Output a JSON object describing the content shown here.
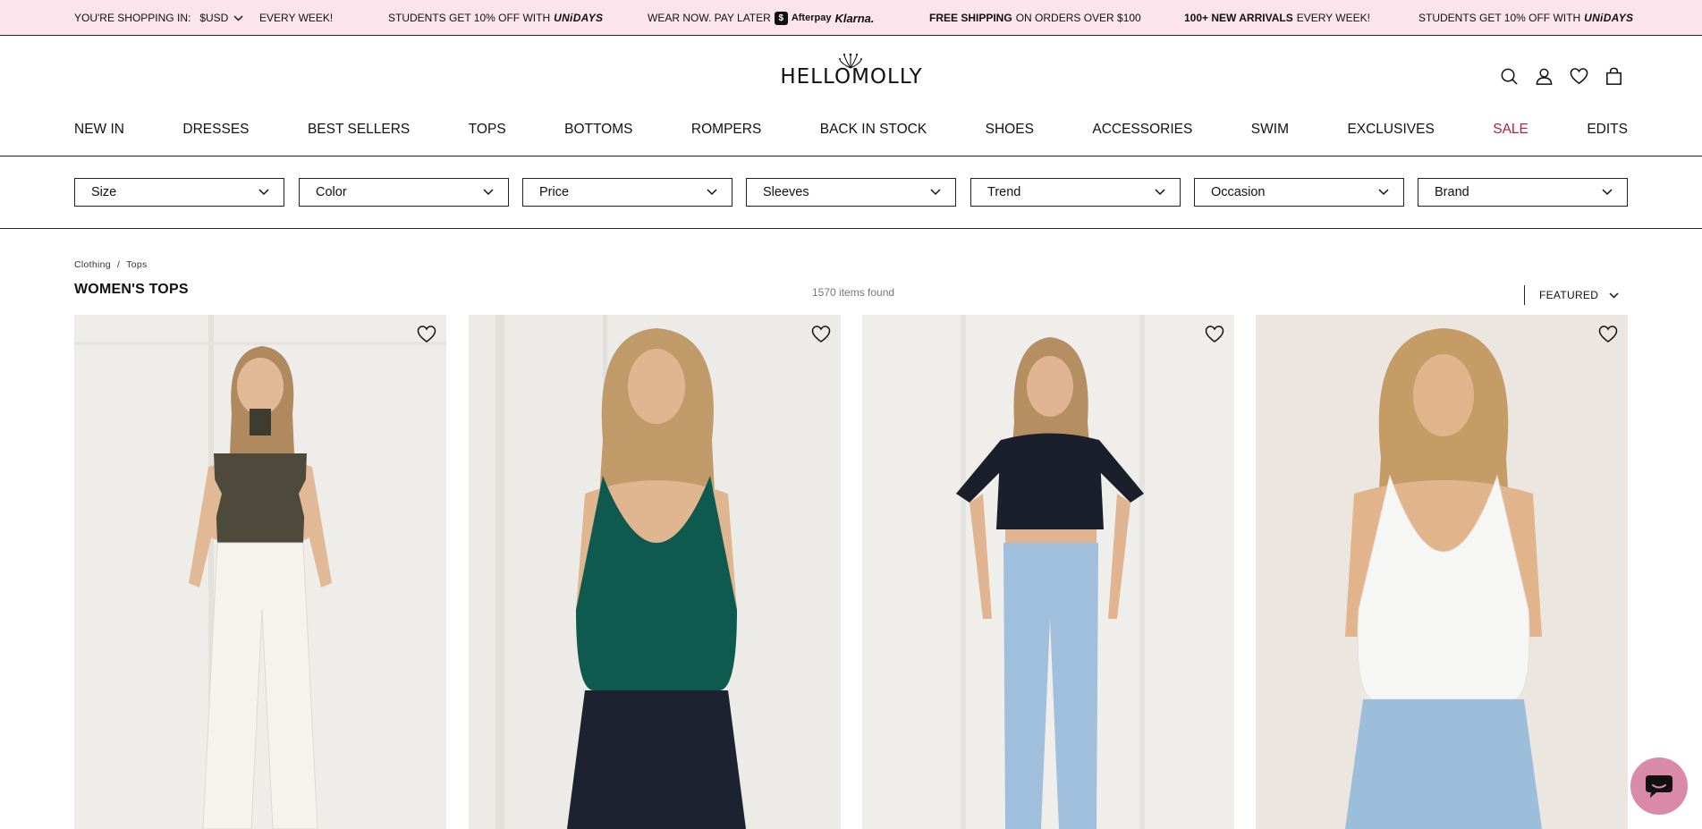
{
  "announcement": {
    "currency_label": "YOU'RE SHOPPING IN:",
    "currency_value": "$USD",
    "ticker": [
      {
        "pre": "",
        "bold": "",
        "post": "EVERY WEEK!"
      },
      {
        "pre": "STUDENTS GET 10% OFF WITH",
        "bold": "UNiDAYS",
        "post": ""
      },
      {
        "pre": "WEAR NOW. PAY LATER",
        "bold": "",
        "post": ""
      },
      {
        "pre": "",
        "bold": "FREE SHIPPING",
        "post": "ON ORDERS OVER $100"
      },
      {
        "pre": "",
        "bold": "100+ NEW ARRIVALS",
        "post": "EVERY WEEK!"
      },
      {
        "pre": "STUDENTS GET 10% OFF WITH",
        "bold": "UNiDAYS",
        "post": ""
      }
    ],
    "afterpay_label": "Afterpay",
    "klarna_label": "Klarna."
  },
  "header": {
    "logo_text": "HELLOMOLLY",
    "icons": [
      "search-icon",
      "account-icon",
      "wishlist-icon",
      "bag-icon"
    ]
  },
  "nav": {
    "items": [
      {
        "label": "NEW IN"
      },
      {
        "label": "DRESSES"
      },
      {
        "label": "BEST SELLERS"
      },
      {
        "label": "TOPS"
      },
      {
        "label": "BOTTOMS"
      },
      {
        "label": "ROMPERS"
      },
      {
        "label": "BACK IN STOCK"
      },
      {
        "label": "SHOES"
      },
      {
        "label": "ACCESSORIES"
      },
      {
        "label": "SWIM"
      },
      {
        "label": "EXCLUSIVES"
      },
      {
        "label": "SALE"
      },
      {
        "label": "EDITS"
      }
    ],
    "sale_color": "#b3223a"
  },
  "filters": [
    {
      "label": "Size"
    },
    {
      "label": "Color"
    },
    {
      "label": "Price"
    },
    {
      "label": "Sleeves"
    },
    {
      "label": "Trend"
    },
    {
      "label": "Occasion"
    },
    {
      "label": "Brand"
    }
  ],
  "listing": {
    "breadcrumb": [
      "Clothing",
      "/",
      "Tops"
    ],
    "title": "WOMEN'S TOPS",
    "count": "1570 items found",
    "sort_label": "FEATURED"
  },
  "products": [
    {
      "name": "product-olive-strapless-top",
      "top_color": "#4d4a3c",
      "bottom_color": "#f4f3ee"
    },
    {
      "name": "product-teal-cowl-halter-top",
      "top_color": "#0f5a4e",
      "bottom_color": "#1c2230"
    },
    {
      "name": "product-black-baby-tee",
      "top_color": "#1b1f2c",
      "bottom_color": "#9fbfdc"
    },
    {
      "name": "product-white-cowl-halter-top",
      "top_color": "#f6f6f4",
      "bottom_color": "#9cbedb"
    }
  ],
  "colors": {
    "announcement_bg": "#fbe4ec",
    "chat_bg": "#d98aa6"
  }
}
